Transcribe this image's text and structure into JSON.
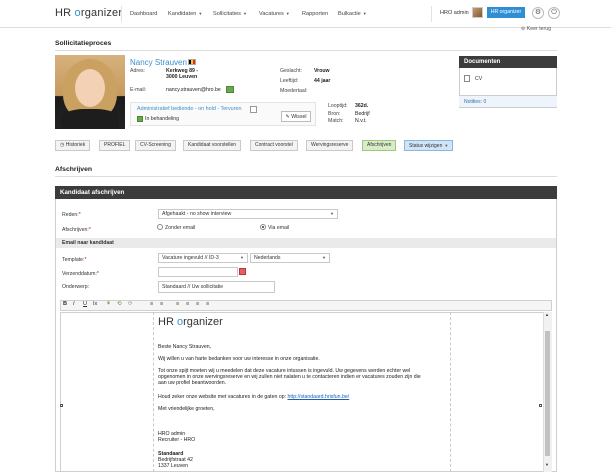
{
  "nav": {
    "logo_a": "HR ",
    "logo_o": "o",
    "logo_b": "rganizer",
    "items": [
      "Dashboard",
      "Kandidaten",
      "Sollicitaties",
      "Vacatures",
      "Rapporten",
      "Bulkactie"
    ],
    "user_name": "HRO admin",
    "user_button": "HR organizer",
    "back_link": "Keer terug"
  },
  "page": {
    "title": "Sollicitatieproces"
  },
  "candidate": {
    "name": "Nancy Strauven",
    "adres_label": "Adres:",
    "adres_line1": "Kerkweg 89 -",
    "adres_line2": "3000 Leuven",
    "email_label": "E-mail:",
    "email": "nancy.strauven@hro.be",
    "geslacht_label": "Geslacht:",
    "geslacht": "Vrouw",
    "leeftijd_label": "Leeftijd:",
    "leeftijd": "44 jaar",
    "moedertaal_label": "Moedertaal:",
    "moedertaal": "",
    "job_title": "Administratief bediende - on hold - Tervuren",
    "status": "In behandeling",
    "wissel_label": "Wissel",
    "looptijd_label": "Looptijd:",
    "looptijd": "362d.",
    "bron_label": "Bron:",
    "bron": "Bedrijf",
    "match_label": "Match:",
    "match": "N.v.t."
  },
  "documents": {
    "title": "Documenten",
    "items": [
      "CV"
    ],
    "notes": "Notities: 0"
  },
  "steps": [
    "Historiek",
    "PROFIEL",
    "CV-Screening",
    "Kandidaat voorstellen",
    "Contract voorstel",
    "Wervingsreserve",
    "Afschrijven",
    "Status wijzigen"
  ],
  "afschrijven": {
    "section_title": "Afschrijven",
    "panel_title": "Kandidaat afschrijven",
    "reden_label": "Reden:",
    "reden_value": "Afgehaakt - no show interview",
    "afschrijven_label": "Afschrijven:",
    "radio_zonder": "Zonder email",
    "radio_via": "Via email",
    "email_section": "Email naar kandidaat",
    "template_label": "Template:",
    "template_value": "Vacature ingevuld // ID-3",
    "language_value": "Nederlands",
    "verzenddatum_label": "Verzenddatum:",
    "verzenddatum_value": "",
    "onderwerp_label": "Onderwerp:",
    "onderwerp_value": "Standaard // Uw sollicitatie"
  },
  "editor": {
    "toolbar": [
      "B",
      "I",
      "U",
      "Ix",
      "⚘",
      "⟲",
      "⟳",
      "≡",
      "≡",
      "≡",
      "≡",
      "≡",
      "≡"
    ],
    "logo_a": "HR ",
    "logo_o": "o",
    "logo_b": "rganizer",
    "greeting": "Beste Nancy Strauven,",
    "p1": "Wij willen u van harte bedanken voor uw interesse in onze organisatie.",
    "p2_l1": "Tot onze spijt moeten wij u meedelen dat deze vacature intussen is ingevuld. Uw gegevens werden echter wel",
    "p2_l2": "opgenomen in onze wervingsreserve en wij zullen niet nalaten u te contacteren indien er vacatures zouden zijn die",
    "p2_l3": "aan uw profiel beantwoorden.",
    "p3_text": "Houd zeker onze website met vacatures in de gaten op:",
    "p3_link": "http://standaard.hrisfun.be/",
    "closing": "Met vriendelijke groeten,",
    "sign_name": "HRO admin",
    "sign_role": "Recruiter - HRO",
    "company": "Standaard",
    "street": "Bedrijfstraat 42",
    "city": "1337 Leuven"
  }
}
